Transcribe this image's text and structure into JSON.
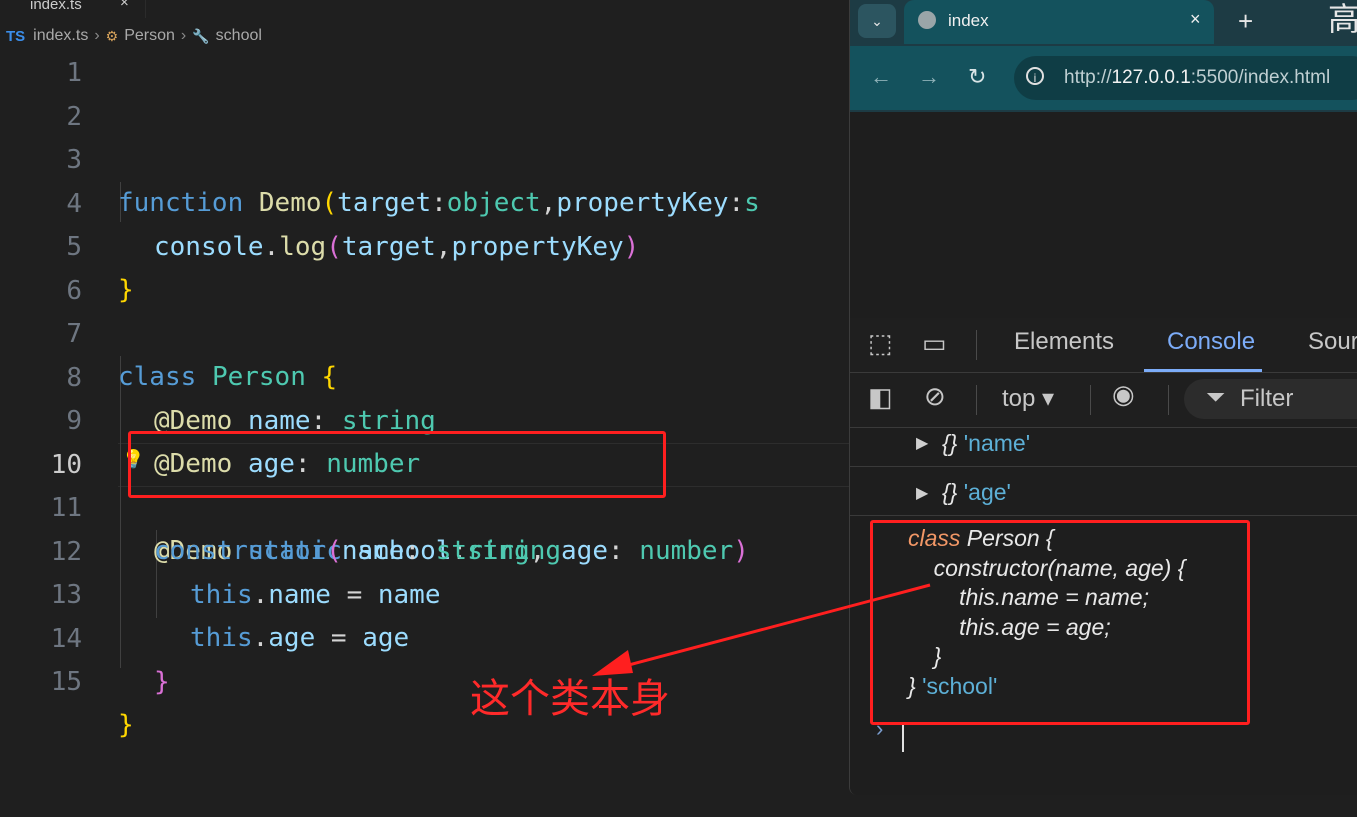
{
  "editor": {
    "tab_title": "index.ts",
    "tab_close": "×",
    "breadcrumb": [
      "index.ts",
      "Person",
      "school"
    ],
    "ts_badge": "TS",
    "line_numbers": [
      "1",
      "2",
      "3",
      "4",
      "5",
      "6",
      "7",
      "8",
      "9",
      "10",
      "11",
      "12",
      "13",
      "14",
      "15"
    ],
    "code": {
      "l3": [
        "function",
        "Demo",
        "(",
        "target",
        ":",
        "object",
        ",",
        "propertyKey",
        ":",
        "s"
      ],
      "l4": [
        "console",
        ".",
        "log",
        "(",
        "target",
        ",",
        "propertyKey",
        ")"
      ],
      "l5": [
        "}"
      ],
      "l7": [
        "class",
        "Person",
        "{"
      ],
      "l8": [
        "@Demo",
        "name",
        ":",
        "string"
      ],
      "l9": [
        "@Demo",
        "age",
        ":",
        "number"
      ],
      "l10": [
        "@Demo",
        "static",
        "school",
        ":",
        "string"
      ],
      "l11": [
        "constructor",
        "(",
        "name",
        ":",
        "string",
        ",",
        "age",
        ":",
        "number",
        ")"
      ],
      "l12": [
        "this",
        ".",
        "name",
        "=",
        "name"
      ],
      "l13": [
        "this",
        ".",
        "age",
        "=",
        "age"
      ],
      "l14": [
        "}"
      ],
      "l15": [
        "}"
      ]
    },
    "annotation": "这个类本身"
  },
  "browser": {
    "tab_title": "index",
    "tab_close": "×",
    "new_tab": "+",
    "corner_char": "高",
    "url_prefix": "http://",
    "url_host": "127.0.0.1",
    "url_rest": ":5500/index.html",
    "devtools": {
      "tabs": [
        "Elements",
        "Console",
        "Sour"
      ],
      "context": "top ▾",
      "filter": "Filter"
    },
    "console": {
      "rows": [
        {
          "obj": "{}",
          "str": "'name'"
        },
        {
          "obj": "{}",
          "str": "'age'"
        }
      ],
      "class_lines": [
        "class",
        " Person {",
        "constructor(name, age) {",
        "this.name = name;",
        "this.age = age;",
        "}",
        "}",
        "'school'"
      ],
      "prompt": "›"
    }
  },
  "colors": {
    "highlight_box": "#ff1f1f",
    "console_active": "#7cacf8"
  }
}
